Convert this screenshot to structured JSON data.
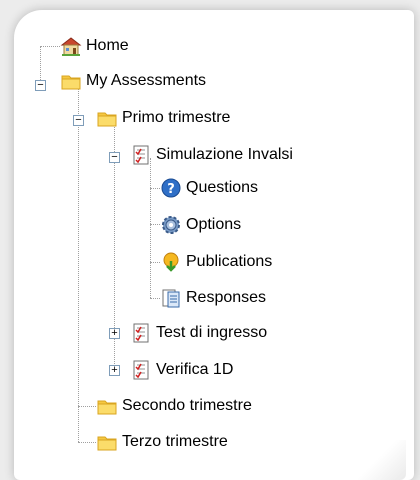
{
  "tree": {
    "home": {
      "label": "Home",
      "icon": "home-icon"
    },
    "my_assessments": {
      "label": "My Assessments",
      "icon": "folder-icon",
      "expanded": true
    },
    "primo_trimestre": {
      "label": "Primo trimestre",
      "icon": "folder-icon",
      "expanded": true
    },
    "simulazione_invalsi": {
      "label": "Simulazione Invalsi",
      "icon": "test-document-icon",
      "expanded": true
    },
    "questions": {
      "label": "Questions",
      "icon": "question-icon"
    },
    "options": {
      "label": "Options",
      "icon": "gear-icon"
    },
    "publications": {
      "label": "Publications",
      "icon": "publications-icon"
    },
    "responses": {
      "label": "Responses",
      "icon": "responses-icon"
    },
    "test_di_ingresso": {
      "label": "Test di ingresso",
      "icon": "test-document-icon",
      "expanded": false
    },
    "verifica_1d": {
      "label": "Verifica 1D",
      "icon": "test-document-icon",
      "expanded": false
    },
    "secondo_trimestre": {
      "label": "Secondo trimestre",
      "icon": "folder-icon"
    },
    "terzo_trimestre": {
      "label": "Terzo trimestre",
      "icon": "folder-icon"
    }
  },
  "toggles": {
    "expanded": "−",
    "collapsed": "+"
  },
  "colors": {
    "folder": "#f5c842",
    "folder_dark": "#d9a520",
    "toggle_border": "#7f9db9",
    "question_blue": "#2f6fc7"
  }
}
